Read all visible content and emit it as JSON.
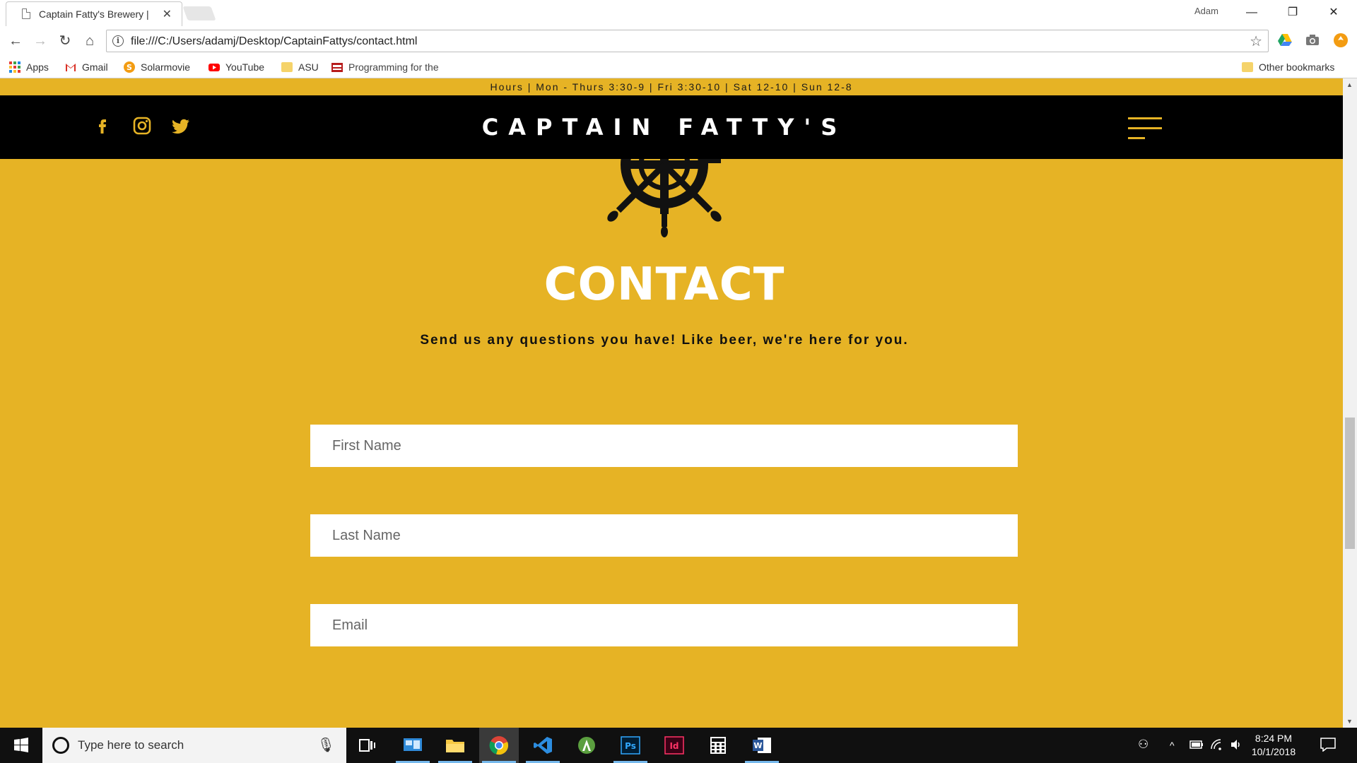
{
  "browser": {
    "tab_title": "Captain Fatty's Brewery |",
    "profile_name": "Adam",
    "url": "file:///C:/Users/adamj/Desktop/CaptainFattys/contact.html",
    "bookmarks": [
      {
        "label": "Apps"
      },
      {
        "label": "Gmail"
      },
      {
        "label": "Solarmovie"
      },
      {
        "label": "YouTube"
      },
      {
        "label": "ASU"
      },
      {
        "label": "Programming for the"
      }
    ],
    "other_bookmarks": "Other bookmarks"
  },
  "site": {
    "hours": "Hours | Mon - Thurs 3:30-9 | Fri 3:30-10 | Sat 12-10 | Sun 12-8",
    "brand": "CAPTAIN FATTY'S",
    "title": "CONTACT",
    "subtitle": "Send us any questions you have! Like beer, we're here for you.",
    "form": {
      "first_name_placeholder": "First Name",
      "last_name_placeholder": "Last Name",
      "email_placeholder": "Email"
    },
    "colors": {
      "accent": "#E6B325",
      "header": "#000000",
      "title": "#FFFFFF"
    }
  },
  "taskbar": {
    "search_placeholder": "Type here to search",
    "time": "8:24 PM",
    "date": "10/1/2018"
  }
}
